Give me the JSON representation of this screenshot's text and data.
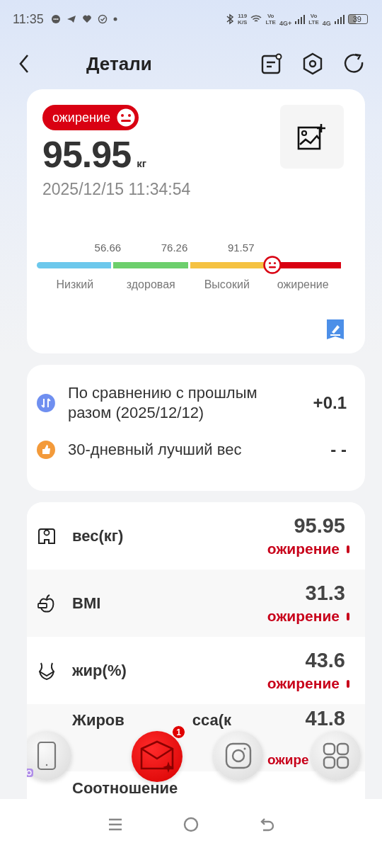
{
  "status_bar": {
    "time": "11:35",
    "speed": "119",
    "speed_unit": "K/S",
    "sim1": "Vo",
    "sim1_sub": "LTE",
    "net1": "4G+",
    "sim2": "Vo",
    "sim2_sub": "LTE",
    "net2": "4G",
    "battery": "39"
  },
  "header": {
    "title": "Детали"
  },
  "summary": {
    "badge": "ожирение",
    "weight": "95.95",
    "unit": "кг",
    "datetime": "2025/12/15 11:34:54",
    "thresholds": [
      "56.66",
      "76.26",
      "91.57"
    ],
    "segments": [
      {
        "label": "Низкий",
        "color": "#6cc8ec"
      },
      {
        "label": "здоровая",
        "color": "#6ccf6c"
      },
      {
        "label": "Высокий",
        "color": "#f5c242"
      },
      {
        "label": "ожирение",
        "color": "#d90012"
      }
    ],
    "marker": {
      "level": 0.775
    }
  },
  "comparison": [
    {
      "kind": "compare",
      "text": "По сравнению с прошлым разом (2025/12/12)",
      "value": "+0.1"
    },
    {
      "kind": "best",
      "text": "30-дневный лучший вес",
      "value": "- -"
    }
  ],
  "metrics": [
    {
      "kind": "scale",
      "label": "вес(кг)",
      "value": "95.95",
      "status": "ожирение"
    },
    {
      "kind": "apple",
      "label": "BMI",
      "value": "31.3",
      "status": "ожирение"
    },
    {
      "kind": "waist",
      "label": "жир(%)",
      "value": "43.6",
      "status": "ожирение"
    }
  ],
  "partial_metric": {
    "label_start": "Жиров",
    "label_end": "сса(к",
    "value": "41.8",
    "status": "ожире"
  },
  "cut_metric": {
    "label": "Соотношение"
  },
  "floating_bubbles": [
    {
      "kind": "phone"
    },
    {
      "kind": "mail",
      "badge": "1"
    },
    {
      "kind": "camera"
    },
    {
      "kind": "grid"
    }
  ]
}
